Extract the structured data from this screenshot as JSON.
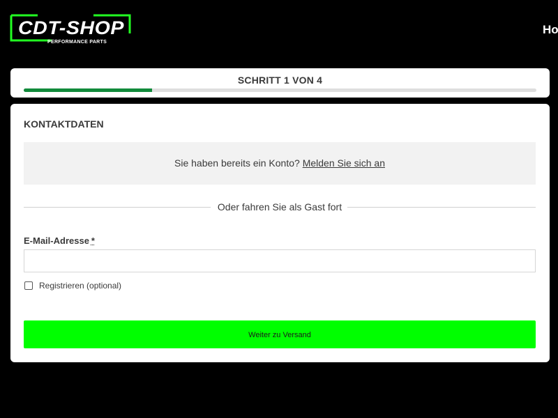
{
  "header": {
    "logo": {
      "text": "CDT-SHOP",
      "tagline": "PERFORMANCE PARTS",
      "accent": "#22ff22"
    },
    "nav_partial": "Ho"
  },
  "progress": {
    "label": "SCHRITT 1 VON 4",
    "current_step": 1,
    "total_steps": 4,
    "fraction": 0.25,
    "fill_color": "#118a3b"
  },
  "contact": {
    "title": "KONTAKTDATEN",
    "login_prompt": "Sie haben bereits ein Konto?",
    "login_link": "Melden Sie sich an",
    "guest_divider": "Oder fahren Sie als Gast fort",
    "email_label": "E-Mail-Adresse",
    "required_mark": "*",
    "email_value": "",
    "register_label": "Registrieren (optional)",
    "register_checked": false,
    "submit_label": "Weiter zu Versand",
    "submit_color": "#00ff00"
  }
}
